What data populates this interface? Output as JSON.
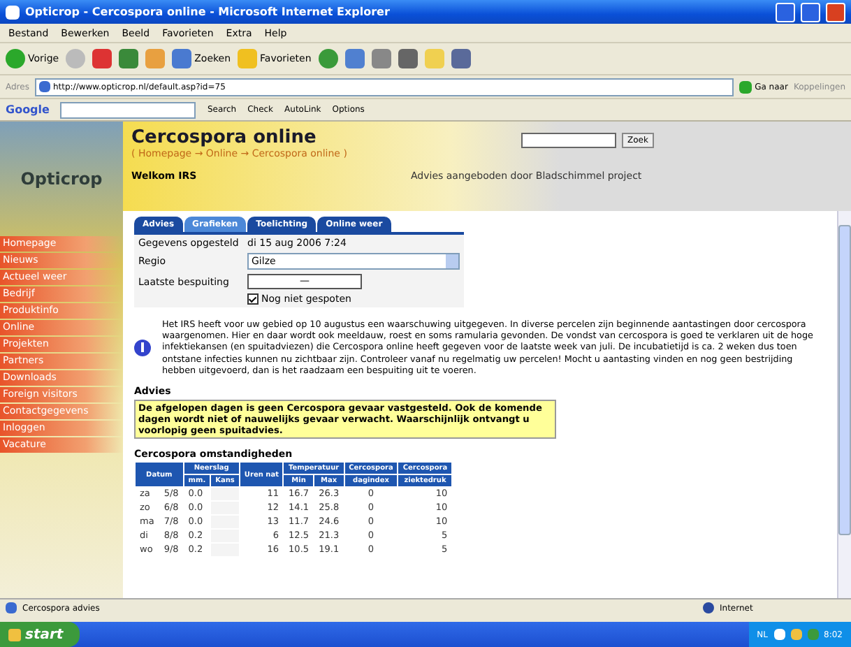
{
  "window": {
    "title": "Opticrop - Cercospora online - Microsoft Internet Explorer"
  },
  "menu": [
    "Bestand",
    "Bewerken",
    "Beeld",
    "Favorieten",
    "Extra",
    "Help"
  ],
  "toolbar": [
    {
      "kind": "back",
      "label": "Vorige"
    },
    {
      "kind": "forward"
    },
    {
      "kind": "stop"
    },
    {
      "kind": "refresh"
    },
    {
      "kind": "home"
    },
    {
      "kind": "search",
      "label": "Zoeken"
    },
    {
      "kind": "favorites",
      "label": "Favorieten"
    },
    {
      "kind": "history"
    },
    {
      "kind": "mail"
    },
    {
      "kind": "print"
    },
    {
      "kind": "edit"
    },
    {
      "kind": "folder"
    },
    {
      "kind": "messenger"
    }
  ],
  "address": {
    "label": "Adres",
    "value": "http://www.opticrop.nl/default.asp?id=75",
    "go": "Ga naar",
    "links": "Koppelingen"
  },
  "google_bar": {
    "logo": "Google",
    "buttons": [
      "Search",
      "Check",
      "AutoLink",
      "Options"
    ]
  },
  "site": {
    "logo": "Opticrop",
    "title": "Cercospora online",
    "breadcrumb": "( Homepage → Online → Cercospora online )",
    "welcome": "Welkom IRS",
    "tagline": "Advies aangeboden door Bladschimmel project",
    "search_button": "Zoek"
  },
  "nav": [
    "Homepage",
    "Nieuws",
    "Actueel weer",
    "Bedrijf",
    "Produktinfo",
    "Online",
    "Projekten",
    "Partners",
    "Downloads",
    "Foreign visitors",
    "Contactgegevens",
    "Inloggen",
    "Vacature"
  ],
  "tabs": [
    {
      "label": "Advies",
      "selected": false
    },
    {
      "label": "Grafieken",
      "selected": true
    },
    {
      "label": "Toelichting",
      "selected": false
    },
    {
      "label": "Online weer",
      "selected": false
    }
  ],
  "form": {
    "date_label": "Gegevens opgesteld",
    "date_value": "di 15 aug 2006 7:24",
    "region_label": "Regio",
    "region_value": "Gilze",
    "spray_label": "Laatste bespuiting",
    "spray_value": "—",
    "not_sprayed": {
      "label": "Nog niet gespoten",
      "checked": true
    }
  },
  "notice": "Het IRS heeft voor uw gebied op 10 augustus een waarschuwing uitgegeven. In diverse percelen zijn beginnende aantastingen door cercospora waargenomen. Hier en daar wordt ook meeldauw, roest en soms ramularia gevonden. De vondst van cercospora is goed te verklaren uit de hoge infektiekansen (en spuitadviezen) die Cercospora online heeft gegeven voor de laatste week van juli. De incubatietijd is ca. 2 weken dus toen ontstane infecties kunnen nu zichtbaar zijn. Controleer vanaf nu regelmatig uw percelen! Mocht u aantasting vinden en nog geen bestrijding hebben uitgevoerd, dan is het raadzaam een bespuiting uit te voeren.",
  "advice": {
    "heading": "Advies",
    "text": "De afgelopen dagen is geen Cercospora gevaar vastgesteld. Ook de komende dagen wordt niet of nauwelijks gevaar verwacht. Waarschijnlijk ontvangt u voorlopig geen spuitadvies."
  },
  "table": {
    "title": "Cercospora omstandigheden",
    "groups": [
      "Datum",
      "Neerslag",
      "Uren nat",
      "Temperatuur",
      "Cercospora",
      "Cercospora"
    ],
    "subheaders": [
      "mm.",
      "Kans",
      "Min",
      "Max",
      "dagindex",
      "ziektedruk"
    ],
    "rows": [
      [
        "za",
        "5/8",
        "0.0",
        "11",
        "16.7",
        "26.3",
        "0",
        "10"
      ],
      [
        "zo",
        "6/8",
        "0.0",
        "12",
        "14.1",
        "25.8",
        "0",
        "10"
      ],
      [
        "ma",
        "7/8",
        "0.0",
        "13",
        "11.7",
        "24.6",
        "0",
        "10"
      ],
      [
        "di",
        "8/8",
        "0.2",
        "6",
        "12.5",
        "21.3",
        "0",
        "5"
      ],
      [
        "wo",
        "9/8",
        "0.2",
        "16",
        "10.5",
        "19.1",
        "0",
        "5"
      ]
    ]
  },
  "status_bar": {
    "text": "Cercospora advies",
    "zone": "Internet"
  },
  "taskbar": {
    "start": "start",
    "language": "NL",
    "time": "8:02"
  }
}
